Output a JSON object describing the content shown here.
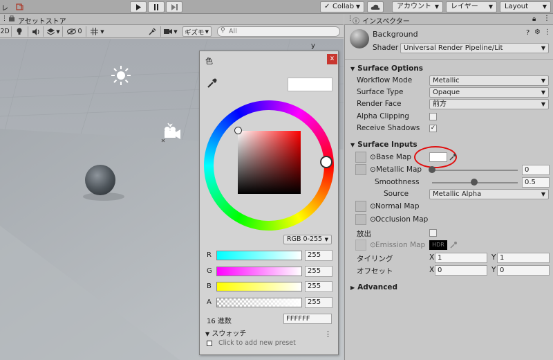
{
  "toolbar": {
    "left_label": "レ",
    "collab_label": "Collab",
    "account_label": "アカウント",
    "layers_label": "レイヤー",
    "layout_label": "Layout",
    "play_icon": "play-icon",
    "pause_icon": "pause-icon",
    "step_icon": "step-icon"
  },
  "scene": {
    "tab_title": "アセットストア",
    "mode_2d": "2D",
    "hidden_count": "0",
    "gizmos_label": "ギズモ",
    "search_placeholder": "All",
    "axis_label": "y"
  },
  "color_picker": {
    "title": "色",
    "close_label": "x",
    "mode_label": "RGB 0-255",
    "channels": [
      {
        "label": "R",
        "value": "255"
      },
      {
        "label": "G",
        "value": "255"
      },
      {
        "label": "B",
        "value": "255"
      },
      {
        "label": "A",
        "value": "255"
      }
    ],
    "hex_label": "16 進数",
    "hex_value": "FFFFFF",
    "swatches_label": "スウォッチ",
    "add_preset_label": "Click to add new preset",
    "more_label": "⋮"
  },
  "inspector": {
    "tab_title": "インスペクター",
    "material_name": "Background",
    "shader_label": "Shader",
    "shader_value": "Universal Render Pipeline/Lit",
    "surface_options": {
      "title": "Surface Options",
      "workflow_label": "Workflow Mode",
      "workflow_value": "Metallic",
      "surface_type_label": "Surface Type",
      "surface_type_value": "Opaque",
      "render_face_label": "Render Face",
      "render_face_value": "前方",
      "alpha_clip_label": "Alpha Clipping",
      "receive_shadows_label": "Receive Shadows"
    },
    "surface_inputs": {
      "title": "Surface Inputs",
      "base_map_label": "Base Map",
      "metallic_map_label": "Metallic Map",
      "metallic_value": "0",
      "smoothness_label": "Smoothness",
      "smoothness_value": "0.5",
      "source_label": "Source",
      "source_value": "Metallic Alpha",
      "normal_map_label": "Normal Map",
      "occlusion_map_label": "Occlusion Map",
      "emission_label": "放出",
      "emission_map_label": "Emission Map",
      "hdr_label": "HDR",
      "tiling_label": "タイリング",
      "tiling_x_label": "X",
      "tiling_x": "1",
      "tiling_y_label": "Y",
      "tiling_y": "1",
      "offset_label": "オフセット",
      "offset_x_label": "X",
      "offset_x": "0",
      "offset_y_label": "Y",
      "offset_y": "0"
    },
    "advanced_label": "Advanced"
  },
  "colors": {
    "highlight_ring": "#e01010",
    "base_color": "#ffffff"
  }
}
